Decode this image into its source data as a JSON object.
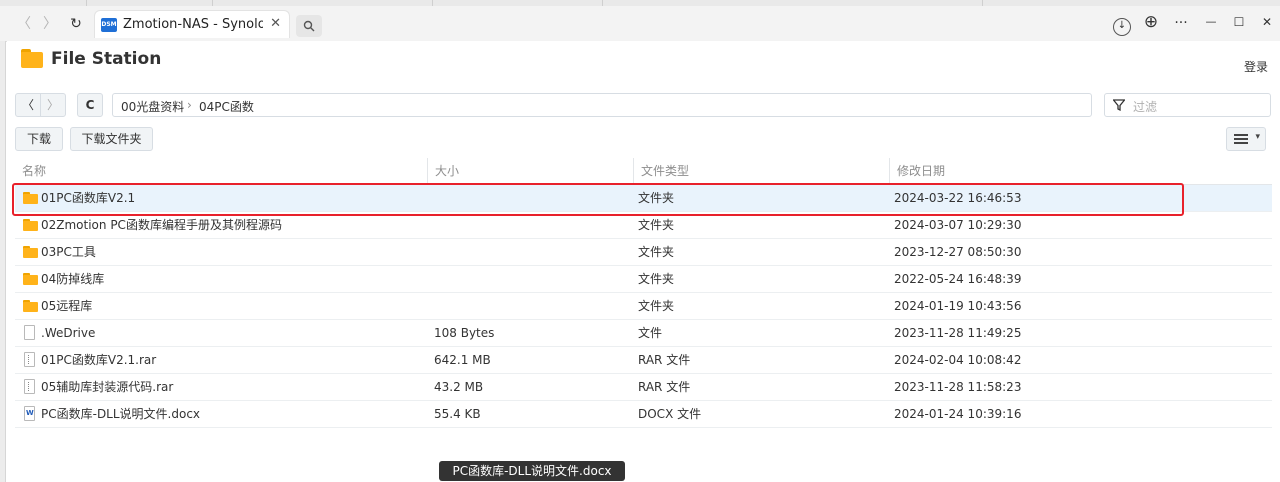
{
  "browser": {
    "tab_title": "Zmotion-NAS - Synology N",
    "favicon_label": "DSM",
    "close_glyph": "✕",
    "back_glyph": "〈",
    "forward_glyph": "〉",
    "reload_glyph": "↻",
    "download_glyph": "↓",
    "globe_glyph": "⊕",
    "more_glyph": "···",
    "minimize_glyph": "—",
    "maximize_glyph": "☐",
    "close_window_glyph": "✕"
  },
  "app": {
    "title": "File Station",
    "login_label": "登录"
  },
  "toolbar": {
    "back_glyph": "〈",
    "forward_glyph": "〉",
    "refresh_glyph": "C",
    "path_segments": [
      "00光盘资料",
      "›",
      "04PC函数"
    ],
    "filter_placeholder": "过滤",
    "download_label": "下载",
    "download_folder_label": "下载文件夹"
  },
  "table": {
    "headers": [
      "名称",
      "大小",
      "文件类型",
      "修改日期"
    ],
    "rows": [
      {
        "name": "01PC函数库V2.1",
        "size": "",
        "type": "文件夹",
        "date": "2024-03-22 16:46:53",
        "icon": "folder-icon"
      },
      {
        "name": "02Zmotion PC函数库编程手册及其例程源码",
        "size": "",
        "type": "文件夹",
        "date": "2024-03-07 10:29:30",
        "icon": "folder-icon"
      },
      {
        "name": "03PC工具",
        "size": "",
        "type": "文件夹",
        "date": "2023-12-27 08:50:30",
        "icon": "folder-icon"
      },
      {
        "name": "04防掉线库",
        "size": "",
        "type": "文件夹",
        "date": "2022-05-24 16:48:39",
        "icon": "folder-icon"
      },
      {
        "name": "05远程库",
        "size": "",
        "type": "文件夹",
        "date": "2024-01-19 10:43:56",
        "icon": "folder-icon"
      },
      {
        "name": ".WeDrive",
        "size": "108 Bytes",
        "type": "文件",
        "date": "2023-11-28 11:49:25",
        "icon": "file-icon"
      },
      {
        "name": "01PC函数库V2.1.rar",
        "size": "642.1 MB",
        "type": "RAR 文件",
        "date": "2024-02-04 10:08:42",
        "icon": "archive-icon"
      },
      {
        "name": "05辅助库封装源代码.rar",
        "size": "43.2 MB",
        "type": "RAR 文件",
        "date": "2023-11-28 11:58:23",
        "icon": "archive-icon"
      },
      {
        "name": "PC函数库-DLL说明文件.docx",
        "size": "55.4 KB",
        "type": "DOCX 文件",
        "date": "2024-01-24 10:39:16",
        "icon": "word-document-icon"
      }
    ]
  },
  "tooltip": "PC函数库-DLL说明文件.docx"
}
